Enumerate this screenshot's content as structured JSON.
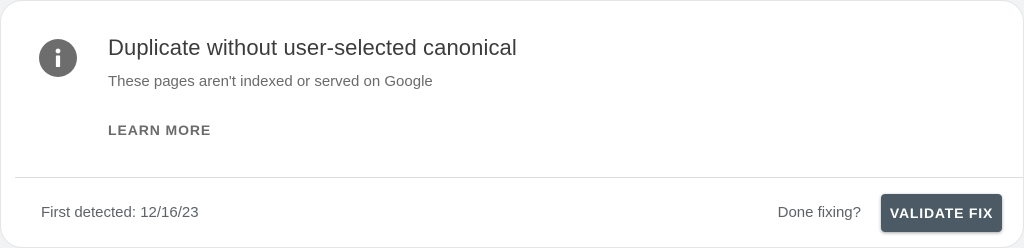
{
  "issue": {
    "icon": "info-icon",
    "title": "Duplicate without user-selected canonical",
    "subtitle": "These pages aren't indexed or served on Google",
    "learn_more_label": "LEARN MORE"
  },
  "footer": {
    "first_detected": "First detected: 12/16/23",
    "done_fixing": "Done fixing?",
    "validate_label": "VALIDATE FIX"
  },
  "colors": {
    "icon_bg": "#6d6d6d",
    "button_bg": "#4b5a64"
  }
}
